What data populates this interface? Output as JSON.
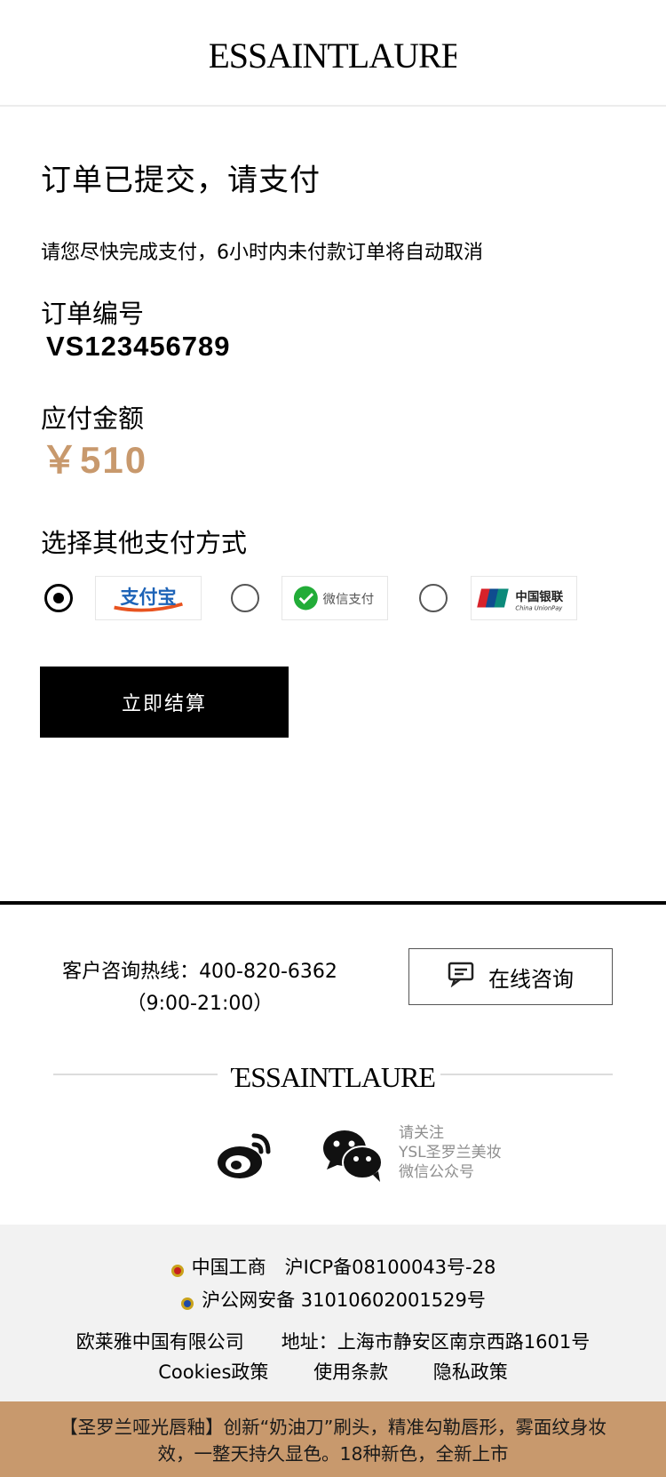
{
  "brand": {
    "logo_text": "YVESSAINTLAURENT"
  },
  "order": {
    "title": "订单已提交，请支付",
    "notice": "请您尽快完成支付，6小时内未付款订单将自动取消",
    "number_label": "订单编号",
    "number": "VS123456789",
    "amount_label": "应付金额",
    "amount": "￥510",
    "accent_color": "#c8996d"
  },
  "payment": {
    "section_title": "选择其他支付方式",
    "methods": [
      {
        "name": "支付宝",
        "logo_text": "支付宝",
        "selected": true
      },
      {
        "name": "微信支付",
        "logo_text": "微信支付",
        "selected": false
      },
      {
        "name": "银联",
        "logo_text": "中国银联",
        "logo_sub": "China UnionPay",
        "selected": false
      }
    ],
    "checkout_label": "立即结算"
  },
  "footer": {
    "hotline_label": "客户咨询热线：400-820-6362",
    "hotline_hours": "（9:00-21:00）",
    "consult_label": "在线咨询",
    "follow_text": [
      "请关注",
      "YSL圣罗兰美妆",
      "微信公众号"
    ],
    "icp": "中国工商　沪ICP备08100043号-28",
    "police": "沪公网安备 31010602001529号",
    "company": "欧莱雅中国有限公司　　地址：上海市静安区南京西路1601号",
    "links": [
      "Cookies政策",
      "使用条款",
      "隐私政策"
    ]
  },
  "promo": {
    "text": "【圣罗兰哑光唇釉】创新“奶油刀”刷头，精准勾勒唇形，雾面纹身妆效，一整天持久显色。18种新色，全新上市"
  }
}
